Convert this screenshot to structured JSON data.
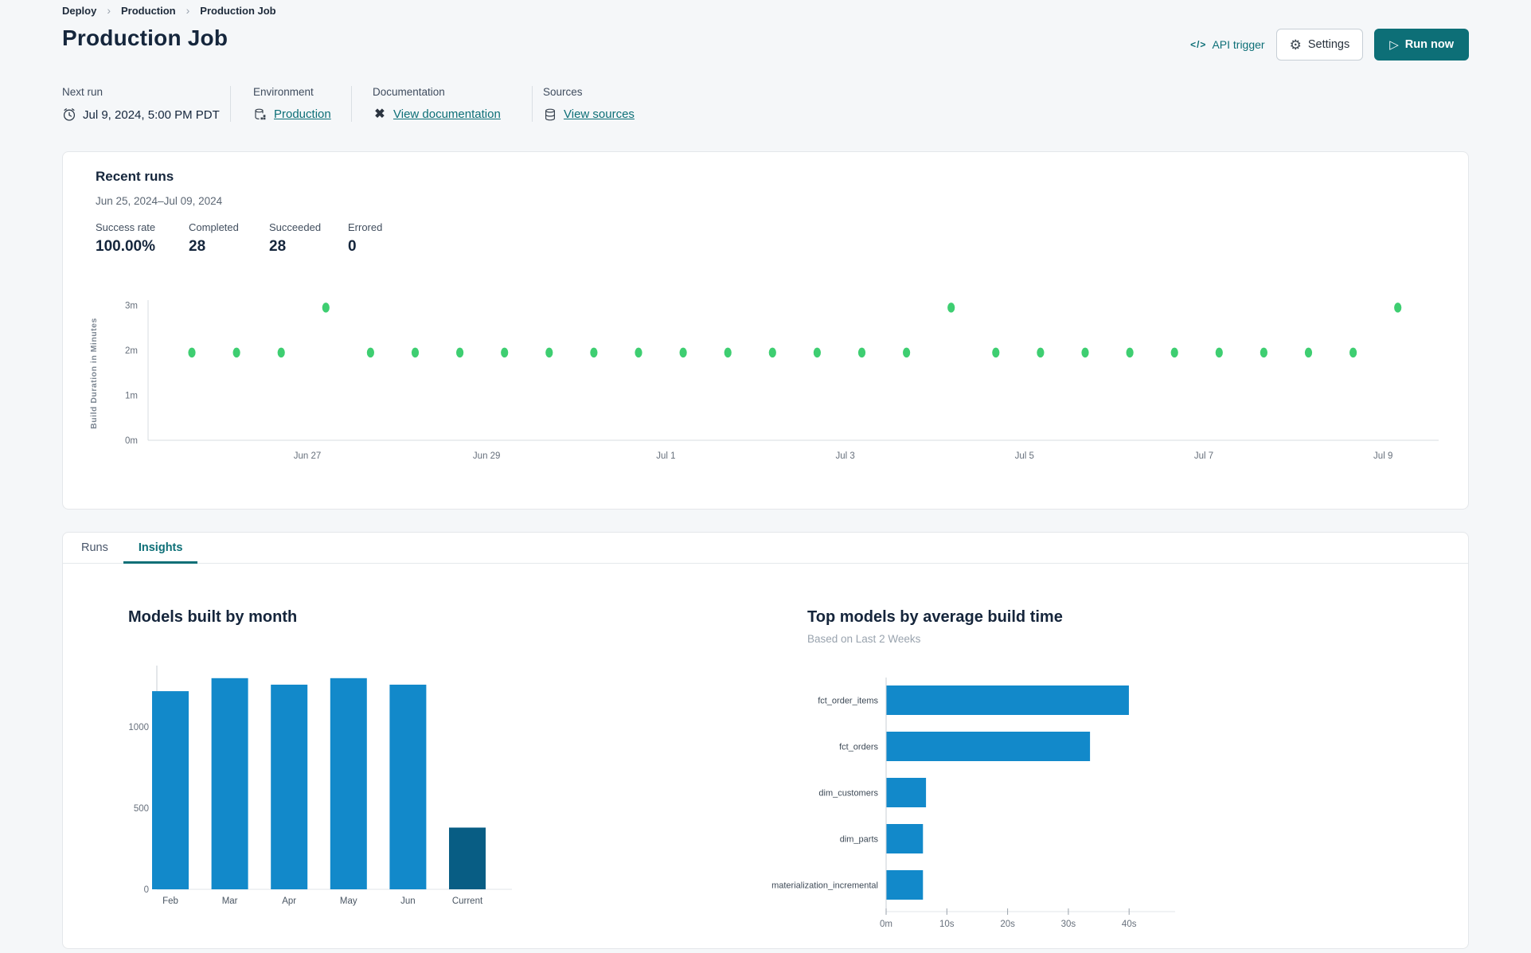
{
  "breadcrumb": {
    "items": [
      "Deploy",
      "Production",
      "Production Job"
    ]
  },
  "header": {
    "title": "Production Job",
    "api_trigger_label": "API trigger",
    "settings_label": "Settings",
    "run_now_label": "Run now"
  },
  "meta": {
    "columns": [
      {
        "label": "Next run",
        "value": "Jul 9, 2024, 5:00 PM PDT",
        "icon": "alarm-clock-icon",
        "link": false
      },
      {
        "label": "Environment",
        "value": "Production",
        "icon": "environment-icon",
        "link": true
      },
      {
        "label": "Documentation",
        "value": "View documentation",
        "icon": "dbt-logo-icon",
        "link": true
      },
      {
        "label": "Sources",
        "value": "View sources",
        "icon": "database-icon",
        "link": true
      }
    ]
  },
  "recent_runs": {
    "title": "Recent runs",
    "date_range": "Jun 25, 2024–Jul 09, 2024",
    "stats": [
      {
        "label": "Success rate",
        "value": "100.00%"
      },
      {
        "label": "Completed",
        "value": "28"
      },
      {
        "label": "Succeeded",
        "value": "28"
      },
      {
        "label": "Errored",
        "value": "0"
      }
    ]
  },
  "tabs": [
    {
      "label": "Runs",
      "active": false
    },
    {
      "label": "Insights",
      "active": true
    }
  ],
  "colors": {
    "accent_teal": "#0d6f77",
    "run_dot_green": "#3ece71",
    "bar_blue": "#1289ca",
    "bar_dark_blue": "#085d84"
  },
  "chart_data": [
    {
      "type": "scatter",
      "name": "build-duration-by-run",
      "ylabel": "Build Duration in Minutes",
      "y_ticks": [
        "0m",
        "1m",
        "2m",
        "3m"
      ],
      "y_tick_minutes": [
        0,
        1,
        2,
        3
      ],
      "x_ticks": [
        "Jun 27",
        "Jun 29",
        "Jul 1",
        "Jul 3",
        "Jul 5",
        "Jul 7",
        "Jul 9"
      ],
      "ylim": [
        0,
        3.3
      ],
      "point_color": "#3ece71",
      "values_minutes": [
        1.95,
        1.95,
        1.95,
        2.95,
        1.95,
        1.95,
        1.95,
        1.95,
        1.95,
        1.95,
        1.95,
        1.95,
        1.95,
        1.95,
        1.95,
        1.95,
        1.95,
        2.95,
        1.95,
        1.95,
        1.95,
        1.95,
        1.95,
        1.95,
        1.95,
        1.95,
        1.95,
        2.95
      ]
    },
    {
      "type": "bar",
      "title": "Models built by month",
      "categories": [
        "Feb",
        "Mar",
        "Apr",
        "May",
        "Jun",
        "Current"
      ],
      "values": [
        1220,
        1300,
        1260,
        1300,
        1260,
        380
      ],
      "y_ticks": [
        0,
        500,
        1000
      ],
      "ylim": [
        0,
        1430
      ],
      "bar_color": "#1289ca",
      "current_bar_color": "#085d84"
    },
    {
      "type": "bar-horizontal",
      "title": "Top models by average build time",
      "subtitle": "Based on Last 2 Weeks",
      "categories": [
        "fct_order_items",
        "fct_orders",
        "dim_customers",
        "dim_parts",
        "materialization_incremental"
      ],
      "values_seconds": [
        39.9,
        33.5,
        6.5,
        6,
        6
      ],
      "x_ticks": [
        "0m",
        "10s",
        "20s",
        "30s",
        "40s"
      ],
      "x_tick_seconds": [
        0,
        10,
        20,
        30,
        40
      ],
      "xlim_seconds": [
        0,
        44
      ],
      "bar_color": "#1289ca"
    }
  ]
}
